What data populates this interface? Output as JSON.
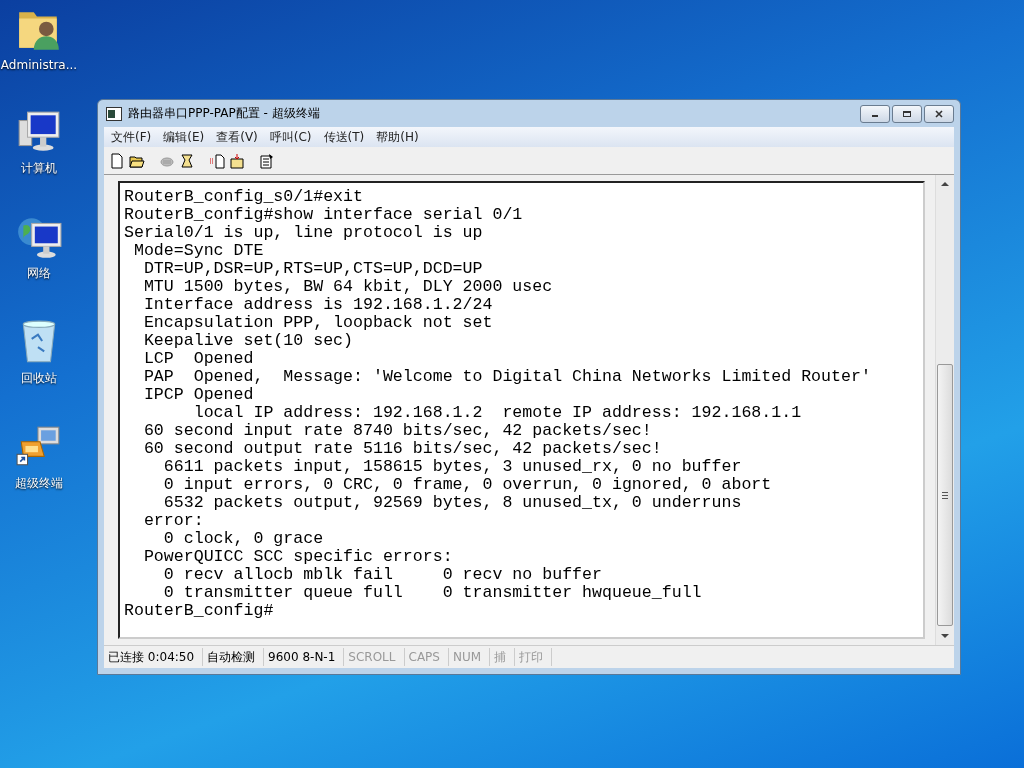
{
  "desktop_icons": [
    {
      "label": "Administra...",
      "kind": "user-folder"
    },
    {
      "label": "计算机",
      "kind": "computer"
    },
    {
      "label": "网络",
      "kind": "network"
    },
    {
      "label": "回收站",
      "kind": "recycle"
    },
    {
      "label": "超级终端",
      "kind": "terminal"
    }
  ],
  "window": {
    "title": "路由器串口PPP-PAP配置 - 超级终端",
    "menu": [
      "文件(F)",
      "编辑(E)",
      "查看(V)",
      "呼叫(C)",
      "传送(T)",
      "帮助(H)"
    ],
    "terminal_lines": [
      "RouterB_config_s0/1#exit",
      "RouterB_config#show interface serial 0/1",
      "Serial0/1 is up, line protocol is up",
      " Mode=Sync DTE",
      "  DTR=UP,DSR=UP,RTS=UP,CTS=UP,DCD=UP",
      "  MTU 1500 bytes, BW 64 kbit, DLY 2000 usec",
      "  Interface address is 192.168.1.2/24",
      "  Encapsulation PPP, loopback not set",
      "  Keepalive set(10 sec)",
      "  LCP  Opened",
      "  PAP  Opened,  Message: 'Welcome to Digital China Networks Limited Router'",
      "  IPCP Opened",
      "       local IP address: 192.168.1.2  remote IP address: 192.168.1.1",
      "  60 second input rate 8740 bits/sec, 42 packets/sec!",
      "  60 second output rate 5116 bits/sec, 42 packets/sec!",
      "    6611 packets input, 158615 bytes, 3 unused_rx, 0 no buffer",
      "    0 input errors, 0 CRC, 0 frame, 0 overrun, 0 ignored, 0 abort",
      "    6532 packets output, 92569 bytes, 8 unused_tx, 0 underruns",
      "  error:",
      "    0 clock, 0 grace",
      "  PowerQUICC SCC specific errors:",
      "    0 recv allocb mblk fail     0 recv no buffer",
      "    0 transmitter queue full    0 transmitter hwqueue_full",
      "RouterB_config#"
    ],
    "status_bar": [
      {
        "text": "已连接 0:04:50",
        "disabled": false
      },
      {
        "text": "自动检测",
        "disabled": false
      },
      {
        "text": "9600 8-N-1",
        "disabled": false
      },
      {
        "text": "SCROLL",
        "disabled": true
      },
      {
        "text": "CAPS",
        "disabled": true
      },
      {
        "text": "NUM",
        "disabled": true
      },
      {
        "text": "捕",
        "disabled": true
      },
      {
        "text": "打印",
        "disabled": true
      }
    ]
  }
}
